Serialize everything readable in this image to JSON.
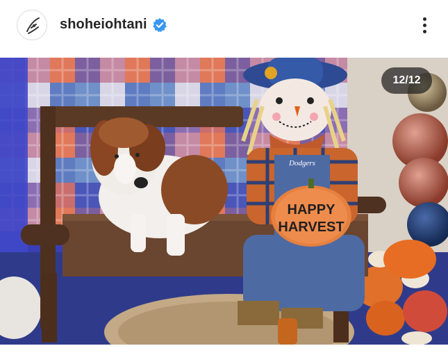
{
  "post": {
    "username": "shoheiohtani",
    "verified": true,
    "avatar_icon": "signature-logo-icon",
    "more_icon": "more-options-icon",
    "slide_counter": "12/12"
  },
  "photo": {
    "sign_text": [
      "HAPPY",
      "HARVEST"
    ],
    "jersey_text": "Dodgers"
  },
  "colors": {
    "verified_blue": "#3897f0",
    "text_primary": "#262626",
    "counter_bg": "#1e1e1e"
  }
}
